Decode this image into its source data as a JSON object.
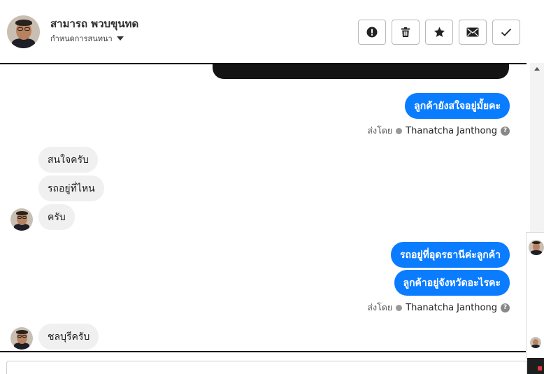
{
  "header": {
    "name": "สามารถ พวบขุนทด",
    "subtitle": "กำหนดการสนทนา",
    "actions": [
      {
        "name": "report",
        "icon": "exclamation-circle-icon"
      },
      {
        "name": "delete",
        "icon": "trash-icon"
      },
      {
        "name": "star",
        "icon": "star-icon"
      },
      {
        "name": "mark-unread",
        "icon": "envelope-icon"
      },
      {
        "name": "done",
        "icon": "checkmark-icon"
      }
    ]
  },
  "messages": [
    {
      "direction": "outgoing",
      "text": "ลูกค้ายังสใจอยู่มั้ยคะ"
    },
    {
      "direction": "incoming",
      "text": "สนใจครับ"
    },
    {
      "direction": "incoming",
      "text": "รถอยู่ที่ไหน"
    },
    {
      "direction": "incoming",
      "text": "ครับ"
    },
    {
      "direction": "outgoing",
      "text": "รถอยู่ที่อุดรธานีค่ะลูกค้า"
    },
    {
      "direction": "outgoing",
      "text": "ลูกค้าอยู่จังหวัดอะไรคะ"
    },
    {
      "direction": "incoming",
      "text": "ชลบุรีครับ"
    }
  ],
  "sent_by": {
    "label": "ส่งโดย",
    "agent": "Thanatcha Janthong",
    "help": "?"
  },
  "colors": {
    "outgoing_bubble": "#0a7cff",
    "incoming_bubble": "#f0f0f0"
  }
}
